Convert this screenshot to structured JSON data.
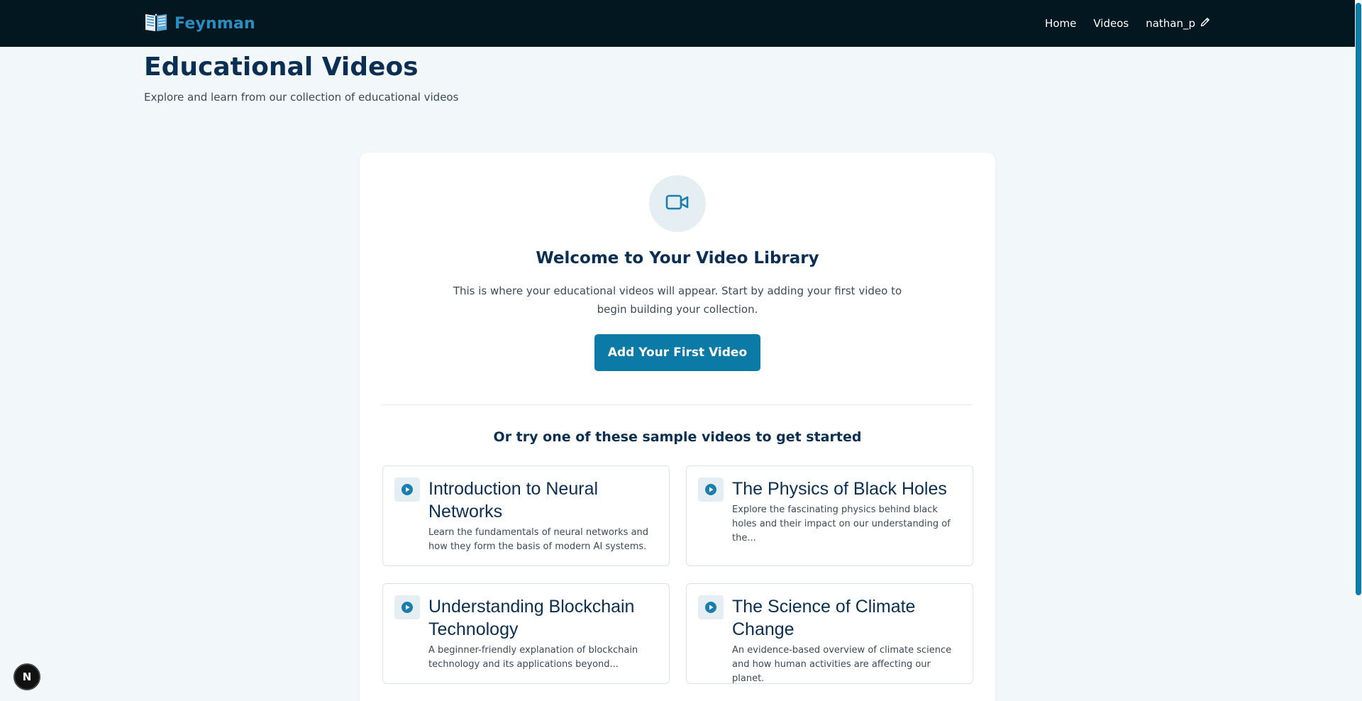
{
  "navbar": {
    "brand": "Feynman",
    "links": [
      "Home",
      "Videos"
    ],
    "user": "nathan_p"
  },
  "header": {
    "title": "Educational Videos",
    "subtitle": "Explore and learn from our collection of educational videos"
  },
  "welcome": {
    "title": "Welcome to Your Video Library",
    "description": "This is where your educational videos will appear. Start by adding your first video to begin building your collection.",
    "button": "Add Your First Video"
  },
  "samples": {
    "heading": "Or try one of these sample videos to get started",
    "items": [
      {
        "title": "Introduction to Neural Networks",
        "description": "Learn the fundamentals of neural networks and how they form the basis of modern AI systems."
      },
      {
        "title": "The Physics of Black Holes",
        "description": "Explore the fascinating physics behind black holes and their impact on our understanding of the..."
      },
      {
        "title": "Understanding Blockchain Technology",
        "description": "A beginner-friendly explanation of blockchain technology and its applications beyond..."
      },
      {
        "title": "The Science of Climate Change",
        "description": "An evidence-based overview of climate science and how human activities are affecting our planet."
      }
    ]
  },
  "dev_badge": "N",
  "colors": {
    "accent": "#0b7aa6",
    "nav_bg": "#031720",
    "brand": "#2a8dc0"
  }
}
